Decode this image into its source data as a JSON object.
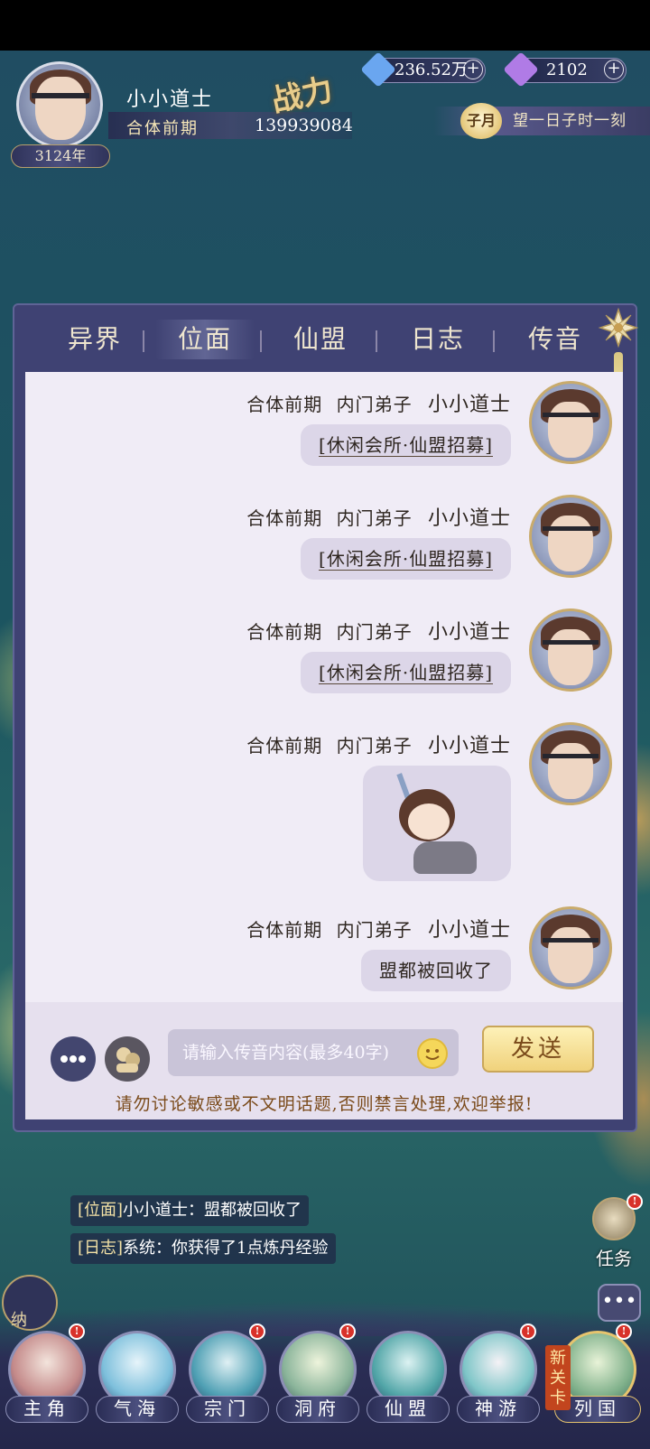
{
  "header": {
    "player_name": "小小道士",
    "age": "3124年",
    "realm": "合体前期",
    "power_label": "战力",
    "power_value": "139939084",
    "resources": [
      {
        "icon": "spirit-crystal-icon",
        "value": "236.52万",
        "color": "#6aa6f0"
      },
      {
        "icon": "immortal-jade-icon",
        "value": "2102",
        "color": "#b07be6"
      }
    ],
    "time": {
      "month": "子月",
      "text": "望一日子时一刻"
    }
  },
  "chat_panel": {
    "tabs": [
      "异界",
      "位面",
      "仙盟",
      "日志",
      "传音"
    ],
    "active_tab": "位面",
    "messages": [
      {
        "realm": "合体前期",
        "rank": "内门弟子",
        "name": "小小道士",
        "type": "link",
        "text": "[休闲会所·仙盟招募]"
      },
      {
        "realm": "合体前期",
        "rank": "内门弟子",
        "name": "小小道士",
        "type": "link",
        "text": "[休闲会所·仙盟招募]"
      },
      {
        "realm": "合体前期",
        "rank": "内门弟子",
        "name": "小小道士",
        "type": "link",
        "text": "[休闲会所·仙盟招募]"
      },
      {
        "realm": "合体前期",
        "rank": "内门弟子",
        "name": "小小道士",
        "type": "sticker",
        "text": ""
      },
      {
        "realm": "合体前期",
        "rank": "内门弟子",
        "name": "小小道士",
        "type": "text",
        "text": "盟都被回收了"
      }
    ],
    "input_placeholder": "请输入传音内容(最多40字)",
    "send_label": "发送",
    "warning": "请勿讨论敏感或不文明话题,否则禁言处理,欢迎举报!"
  },
  "log": [
    {
      "tag": "[位面]",
      "text": "小小道士：盟都被回收了"
    },
    {
      "tag": "[日志]",
      "text": "系统：你获得了1点炼丹经验"
    }
  ],
  "side": {
    "task_label": "任务",
    "na_label": "纳"
  },
  "bottom_nav": {
    "items": [
      "主角",
      "气海",
      "宗门",
      "洞府",
      "仙盟",
      "神游",
      "列国"
    ],
    "new_tag": "新关卡"
  }
}
